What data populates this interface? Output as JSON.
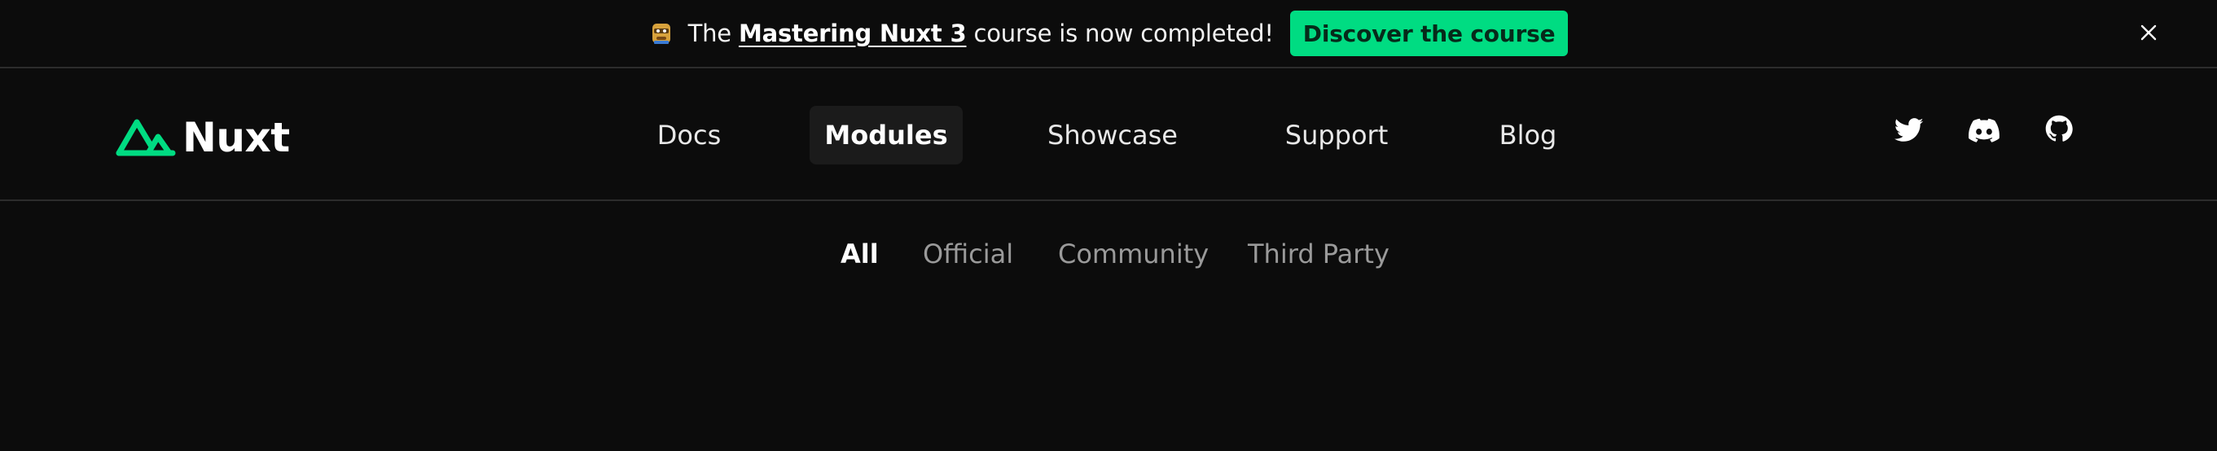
{
  "banner": {
    "emoji_icon": "mastering-nuxt-emoji-icon",
    "text_before": "The ",
    "link_text": "Mastering Nuxt 3",
    "text_after": " course is now completed!",
    "cta_label": "Discover the course",
    "cta_color": "#00dc82",
    "close_icon": "close-icon"
  },
  "header": {
    "logo_text": "Nuxt",
    "logo_color": "#00dc82",
    "nav": [
      {
        "label": "Docs",
        "active": false
      },
      {
        "label": "Modules",
        "active": true
      },
      {
        "label": "Showcase",
        "active": false
      },
      {
        "label": "Support",
        "active": false
      },
      {
        "label": "Blog",
        "active": false
      }
    ],
    "socials": [
      {
        "icon": "twitter-icon"
      },
      {
        "icon": "discord-icon"
      },
      {
        "icon": "github-icon"
      }
    ]
  },
  "filters": [
    {
      "label": "All",
      "active": true
    },
    {
      "label": "Official",
      "active": false
    },
    {
      "label": "Community",
      "active": false
    },
    {
      "label": "Third Party",
      "active": false
    }
  ]
}
